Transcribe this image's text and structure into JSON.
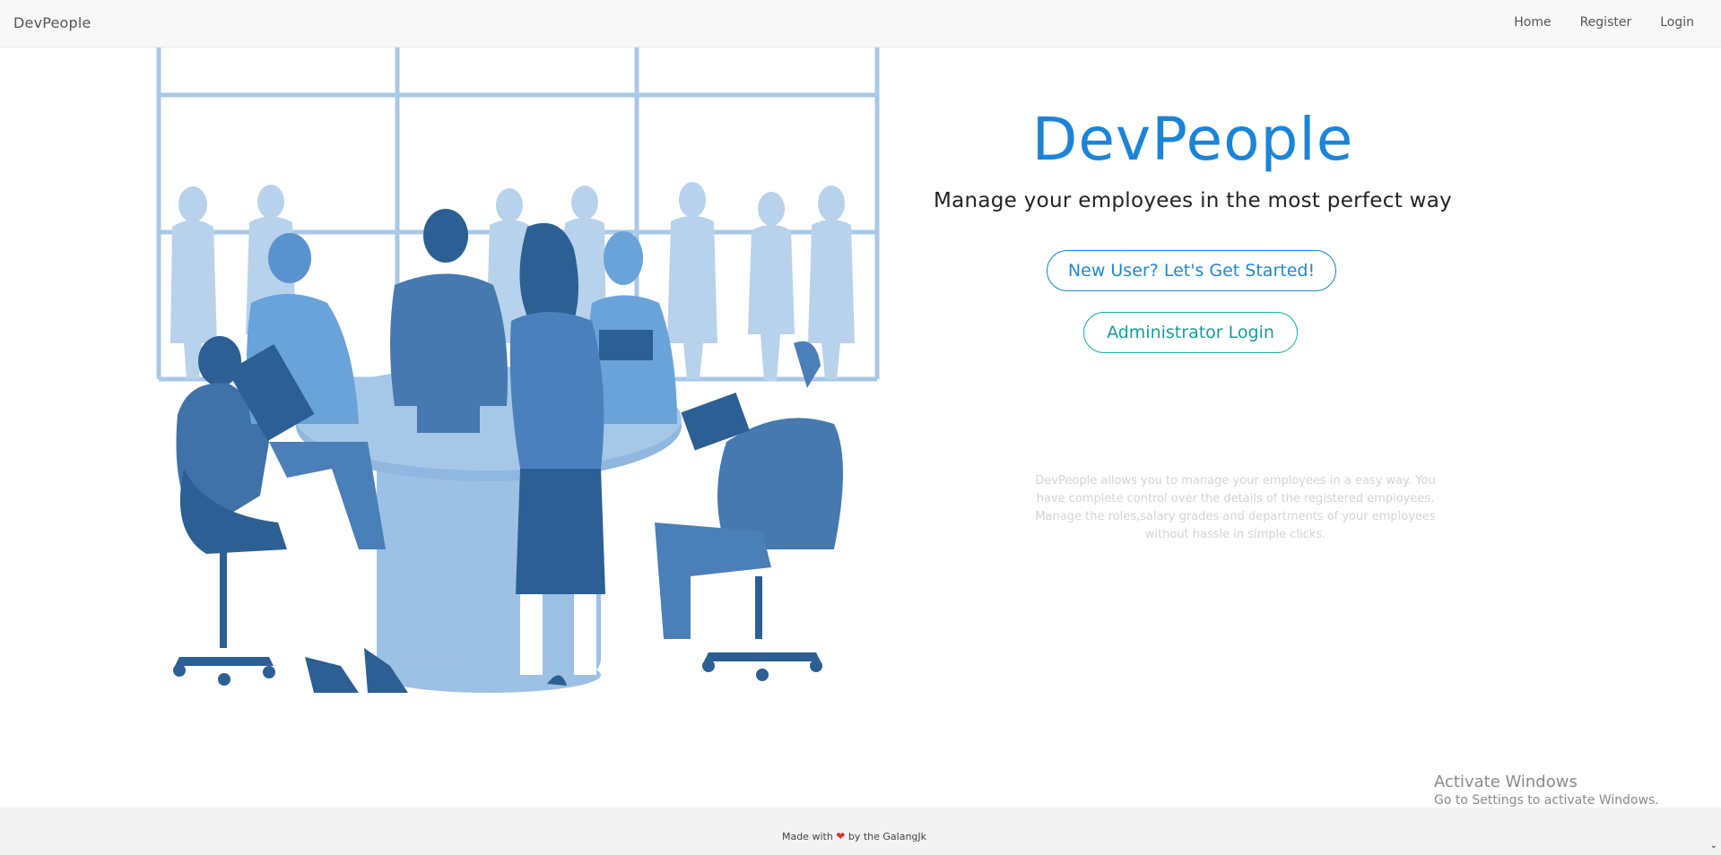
{
  "navbar": {
    "brand": "DevPeople",
    "links": [
      "Home",
      "Register",
      "Login"
    ]
  },
  "hero": {
    "title": "DevPeople",
    "subtitle": "Manage your employees in the most perfect way",
    "cta_button": "New User? Let's Get Started!",
    "admin_button": "Administrator Login"
  },
  "description": "DevPeople allows you to manage your employees in a easy way. You have complete control over the details of the registered employees. Manage the roles,salary grades and departments of your employees without hassle in simple clicks.",
  "footer": {
    "prefix": "Made with",
    "icon": "heart-icon",
    "suffix": "by the GalangJk"
  },
  "os_watermark": {
    "title": "Activate Windows",
    "subtitle": "Go to Settings to activate Windows."
  },
  "colors": {
    "brand_blue": "#1b84d8",
    "teal": "#1eaaa8",
    "illustration_dark": "#2c5f93",
    "illustration_mid": "#4a7fb8",
    "illustration_light": "#9bbfe2"
  }
}
